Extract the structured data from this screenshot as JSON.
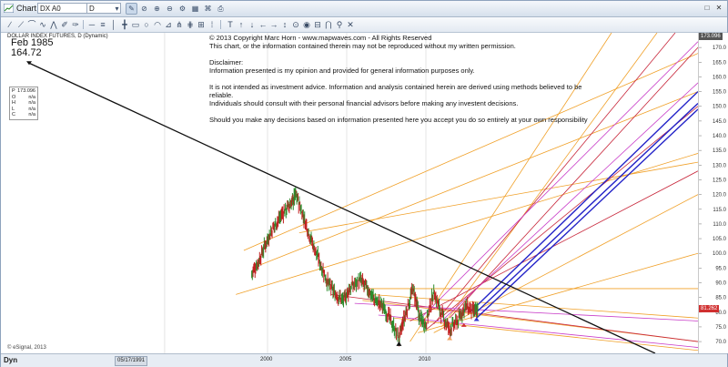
{
  "window": {
    "title": "Chart",
    "symbol": "DX A0",
    "interval": "D",
    "controls": [
      "□",
      "✕"
    ]
  },
  "legend": {
    "title": "DOLLAR INDEX FUTURES, D (Dynamic)",
    "annotation_date": "Feb 1985",
    "annotation_price": "164.72",
    "ohlc": [
      {
        "k": "P",
        "v": "173.096"
      },
      {
        "k": "O",
        "v": "n/a"
      },
      {
        "k": "H",
        "v": "n/a"
      },
      {
        "k": "L",
        "v": "n/a"
      },
      {
        "k": "C",
        "v": "n/a"
      }
    ]
  },
  "notice": {
    "line1": "© 2013 Copyright Marc Horn - www.mapwaves.com    - All Rights Reserved",
    "line2": "This chart, or the information contained therein may not be reproduced without my written permission.",
    "line3": "Disclaimer:",
    "line4": "Information presented is my opinion and provided for general information purposes only.",
    "line5": "It is not intended as investment advice. Information and analysis contained herein are derived using methods believed to be reliable.",
    "line6": "Individuals should consult with their personal financial advisors before making any investent decisions.",
    "line7": "Should you make any decisions based on information presented here you accept you do so entirely at your own responsibility"
  },
  "footer": {
    "dyn": "Dyn",
    "date_marker": "05/17/1991",
    "xticks": [
      "2000",
      "2005",
      "2010"
    ],
    "watermark": "© eSignal, 2013"
  },
  "price_tags": {
    "top": "173.096",
    "current": "81.262"
  },
  "colors": {
    "trendline": "#111111",
    "fork_blue": "#2323c8",
    "fork_red": "#c8283c",
    "fork_orange": "#f0a028",
    "fork_magenta": "#c83cc8",
    "candle_up": "#2a8a2a",
    "candle_down": "#c02020",
    "price_tag": "#d03030"
  },
  "chart_data": {
    "type": "line",
    "title": "",
    "xlabel": "",
    "ylabel": "",
    "ylim": [
      66,
      175
    ],
    "yticks": [
      70,
      75,
      80,
      85,
      90,
      95,
      100,
      105,
      110,
      115,
      120,
      125,
      130,
      135,
      140,
      145,
      150,
      155,
      160,
      165,
      170
    ],
    "xticks": [
      2000,
      2005,
      2010
    ],
    "x": [
      1999.0,
      1999.5,
      2000.0,
      2000.5,
      2001.0,
      2001.5,
      2001.8,
      2002.3,
      2002.8,
      2003.3,
      2003.8,
      2004.3,
      2004.8,
      2005.2,
      2005.8,
      2006.3,
      2006.8,
      2007.3,
      2007.8,
      2008.3,
      2008.7,
      2009.2,
      2009.6,
      2010.0,
      2010.5,
      2011.0,
      2011.5,
      2012.0,
      2012.5,
      2013.0,
      2013.3
    ],
    "series": [
      {
        "values": [
          93,
          98,
          105,
          110,
          114,
          117,
          120,
          112,
          104,
          97,
          90,
          86,
          84,
          88,
          91,
          88,
          84,
          82,
          77,
          71,
          79,
          88,
          78,
          76,
          87,
          79,
          74,
          77,
          82,
          80,
          81
        ]
      }
    ]
  }
}
